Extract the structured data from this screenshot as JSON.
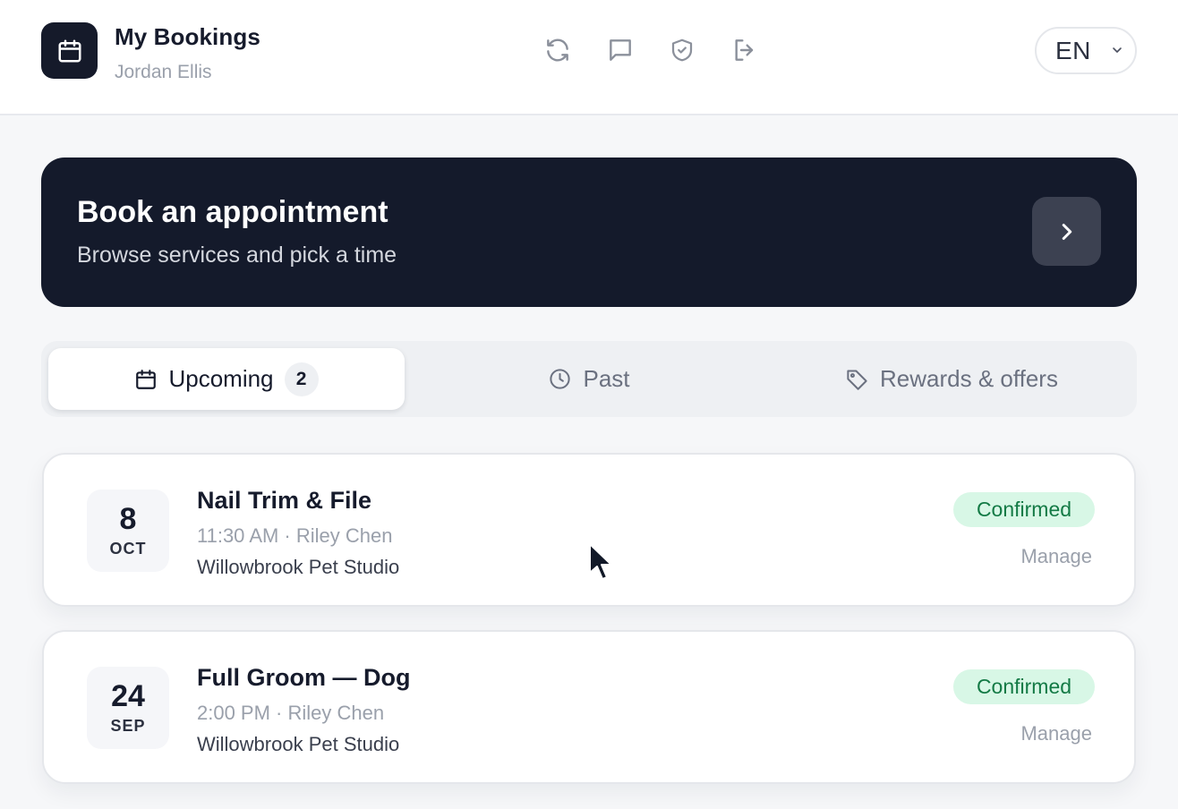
{
  "header": {
    "title": "My Bookings",
    "user": "Jordan Ellis",
    "icons": [
      "calendar-icon",
      "refresh-icon",
      "message-icon",
      "shield-check-icon",
      "logout-icon"
    ],
    "language": "EN"
  },
  "banner": {
    "title": "Book an appointment",
    "subtitle": "Browse services and pick a time"
  },
  "tabs": [
    {
      "label": "Upcoming",
      "icon": "calendar-icon",
      "badge": "2",
      "active": true
    },
    {
      "label": "Past",
      "icon": "clock-icon"
    },
    {
      "label": "Rewards & offers",
      "icon": "tag-icon"
    }
  ],
  "bookings": [
    {
      "day": "8",
      "month": "OCT",
      "service": "Nail Trim & File",
      "meta": "11:30 AM · Riley Chen",
      "location": "Willowbrook Pet Studio",
      "status": "Confirmed",
      "action": "Manage"
    },
    {
      "day": "24",
      "month": "SEP",
      "service": "Full Groom — Dog",
      "meta": "2:00 PM · Riley Chen",
      "location": "Willowbrook Pet Studio",
      "status": "Confirmed",
      "action": "Manage"
    }
  ],
  "colors": {
    "brand_dark": "#141a2b",
    "status_bg": "#d8f7e6",
    "status_text": "#137a45",
    "muted": "#9aa0ab"
  }
}
